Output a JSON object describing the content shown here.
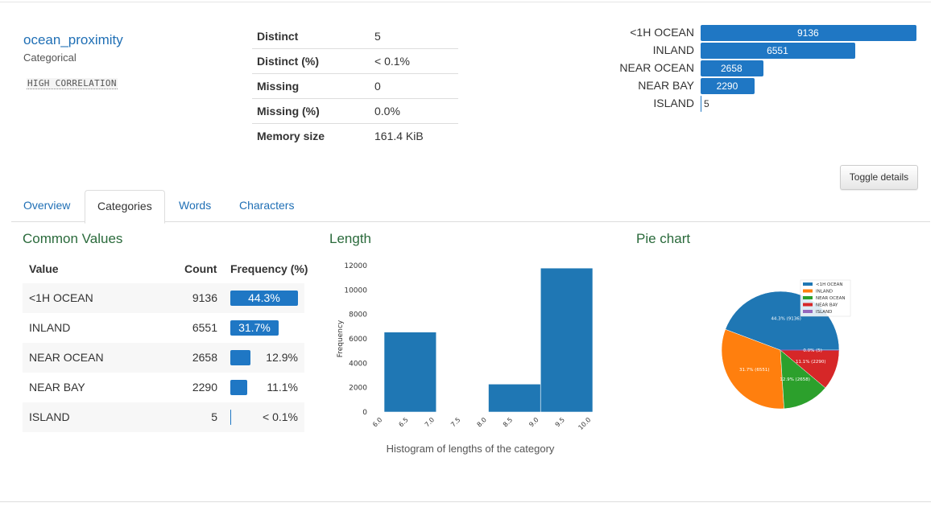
{
  "variable": {
    "name": "ocean_proximity",
    "type": "Categorical",
    "warning": "HIGH CORRELATION"
  },
  "stats": [
    {
      "label": "Distinct",
      "value": "5"
    },
    {
      "label": "Distinct (%)",
      "value": "< 0.1%"
    },
    {
      "label": "Missing",
      "value": "0"
    },
    {
      "label": "Missing (%)",
      "value": "0.0%"
    },
    {
      "label": "Memory size",
      "value": "161.4 KiB"
    }
  ],
  "mini_chart": [
    {
      "label": "<1H OCEAN",
      "value": 9136,
      "text": "9136"
    },
    {
      "label": "INLAND",
      "value": 6551,
      "text": "6551"
    },
    {
      "label": "NEAR OCEAN",
      "value": 2658,
      "text": "2658"
    },
    {
      "label": "NEAR BAY",
      "value": 2290,
      "text": "2290"
    },
    {
      "label": "ISLAND",
      "value": 5,
      "text": "5"
    }
  ],
  "toggle_label": "Toggle details",
  "tabs": [
    {
      "label": "Overview",
      "active": false
    },
    {
      "label": "Categories",
      "active": true
    },
    {
      "label": "Words",
      "active": false
    },
    {
      "label": "Characters",
      "active": false
    }
  ],
  "common_values": {
    "title": "Common Values",
    "headers": {
      "value": "Value",
      "count": "Count",
      "frequency": "Frequency (%)"
    },
    "rows": [
      {
        "value": "<1H OCEAN",
        "count": "9136",
        "pct": "44.3%",
        "fraction": 0.443
      },
      {
        "value": "INLAND",
        "count": "6551",
        "pct": "31.7%",
        "fraction": 0.317
      },
      {
        "value": "NEAR OCEAN",
        "count": "2658",
        "pct": "12.9%",
        "fraction": 0.129
      },
      {
        "value": "NEAR BAY",
        "count": "2290",
        "pct": "11.1%",
        "fraction": 0.111
      },
      {
        "value": "ISLAND",
        "count": "5",
        "pct": "< 0.1%",
        "fraction": 0.0002
      }
    ]
  },
  "length_title": "Length",
  "pie_title": "Pie chart",
  "colors": {
    "blue": "#1f77b4",
    "orange": "#ff7f0e",
    "green": "#2ca02c",
    "red": "#d62728",
    "purple": "#9467bd",
    "link": "#1f6fb5",
    "section": "#2a6a3b"
  },
  "chart_data": [
    {
      "type": "bar",
      "title": "",
      "xlabel": "Histogram of lengths of the category",
      "ylabel": "Frequency",
      "bins": [
        [
          6.0,
          7.0
        ],
        [
          8.0,
          9.0
        ],
        [
          9.0,
          10.0
        ]
      ],
      "values": [
        6551,
        2290,
        11794
      ],
      "xticks": [
        "6.0",
        "6.5",
        "7.0",
        "7.5",
        "8.0",
        "8.5",
        "9.0",
        "9.5",
        "10.0"
      ],
      "yticks": [
        "0",
        "2000",
        "4000",
        "6000",
        "8000",
        "10000",
        "12000"
      ],
      "xlim": [
        6.0,
        10.0
      ],
      "ylim": [
        0,
        12000
      ],
      "grid": false
    },
    {
      "type": "pie",
      "labels": [
        "<1H OCEAN",
        "INLAND",
        "NEAR OCEAN",
        "NEAR BAY",
        "ISLAND"
      ],
      "values": [
        9136,
        6551,
        2658,
        2290,
        5
      ],
      "slice_labels": [
        "44.3% (9136)",
        "31.7% (6551)",
        "12.9% (2658)",
        "11.1% (2290)",
        "0.0% (5)"
      ],
      "colors": [
        "#1f77b4",
        "#ff7f0e",
        "#2ca02c",
        "#d62728",
        "#9467bd"
      ],
      "legend": "top-right"
    }
  ]
}
